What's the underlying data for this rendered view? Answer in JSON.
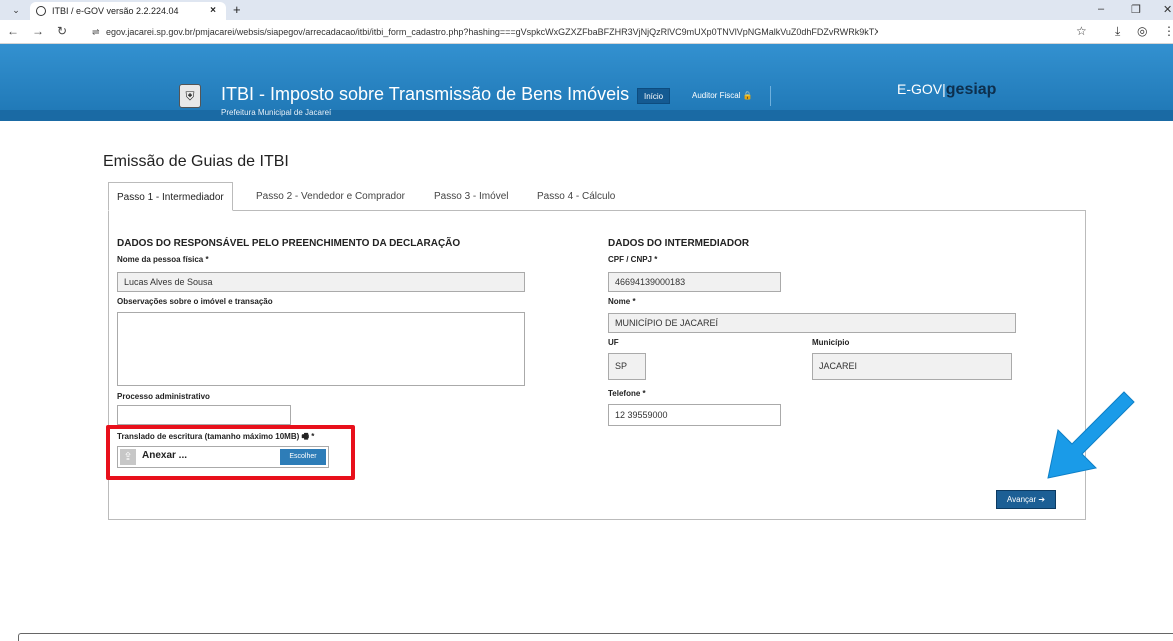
{
  "browser": {
    "tab_title": "ITBI / e-GOV versão 2.2.224.04",
    "tab_close": "×",
    "new_tab": "+",
    "url": "egov.jacarei.sp.gov.br/pmjacarei/websis/siapegov/arrecadacao/itbi/itbi_form_cadastro.php?hashing===gVspkcWxGZXZFbaBFZHR3VjNjQzRlVC9mUXp0TNVlVpNGMalkVuZ0dhFDZvRWRk9kTXFFeW52Y1YlV..."
  },
  "header": {
    "title": "ITBI - Imposto sobre Transmissão de Bens Imóveis",
    "subtitle": "Prefeitura Municipal de Jacareí",
    "nav_inicio": "Início",
    "nav_auditor": "Auditor Fiscal 🔒",
    "brand_left": "E-GOV",
    "brand_right": "gesiap"
  },
  "page": {
    "title": "Emissão de Guias de ITBI",
    "tabs": [
      {
        "label": "Passo 1 - Intermediador",
        "active": true
      },
      {
        "label": "Passo 2 - Vendedor e Comprador",
        "active": false
      },
      {
        "label": "Passo 3 - Imóvel",
        "active": false
      },
      {
        "label": "Passo 4 - Cálculo",
        "active": false
      }
    ]
  },
  "responsavel": {
    "section_title": "DADOS DO RESPONSÁVEL PELO PREENCHIMENTO DA DECLARAÇÃO",
    "nome_label": "Nome da pessoa física *",
    "nome_value": "Lucas Alves de Sousa",
    "obs_label": "Observações sobre o imóvel e transação",
    "obs_value": "",
    "processo_label": "Processo administrativo",
    "processo_value": "",
    "translado_label": "Translado de escritura (tamanho máximo 10MB)",
    "translado_required": " *",
    "upload_text": "Anexar ...",
    "upload_button": "Escolher"
  },
  "intermediador": {
    "section_title": "DADOS DO INTERMEDIADOR",
    "cpf_label": "CPF / CNPJ *",
    "cpf_value": "46694139000183",
    "nome_label": "Nome *",
    "nome_value": "MUNICÍPIO DE JACAREÍ",
    "uf_label": "UF",
    "uf_value": "SP",
    "municipio_label": "Município",
    "municipio_value": "JACAREI",
    "telefone_label": "Telefone *",
    "telefone_value": "12 39559000"
  },
  "actions": {
    "next_label": "Avançar ➔"
  },
  "colors": {
    "header_blue": "#1e76b4",
    "highlight_red": "#e8101b",
    "arrow_blue": "#1a9be8"
  }
}
